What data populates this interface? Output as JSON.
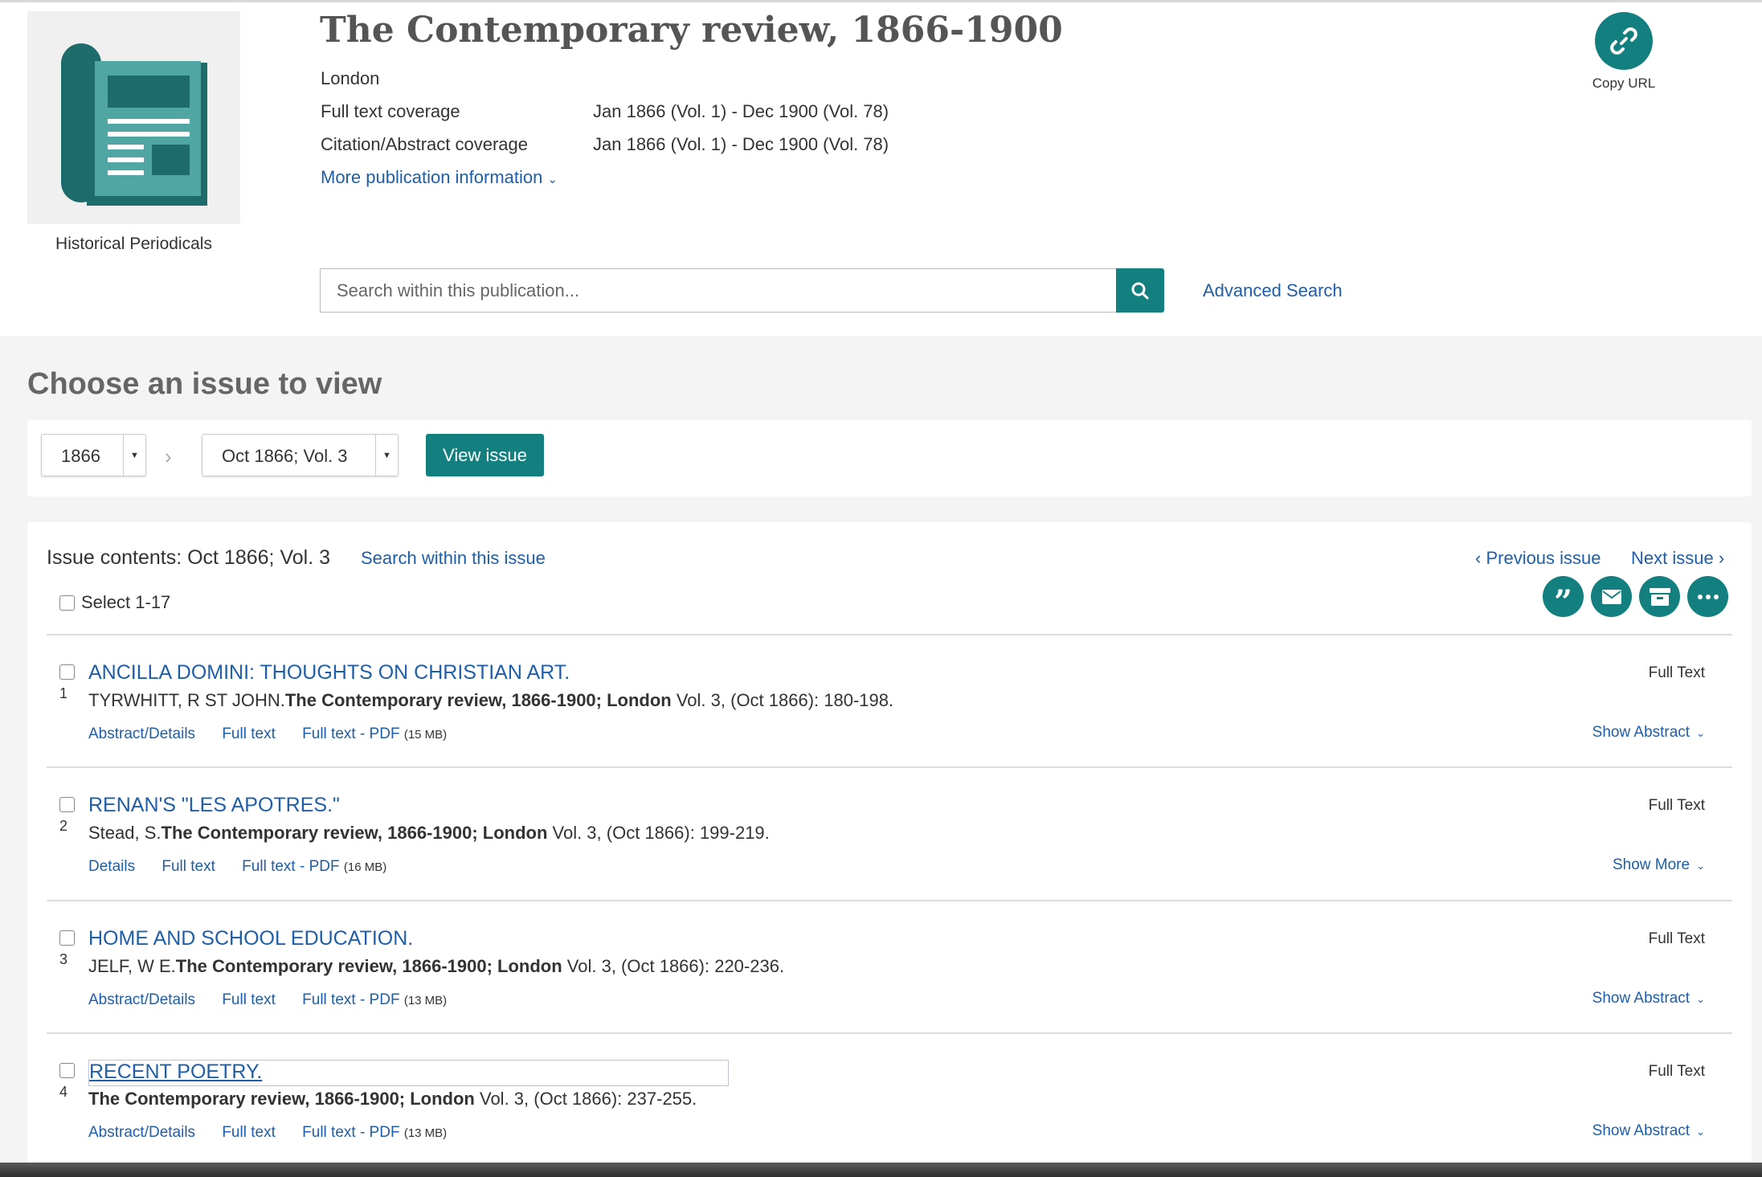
{
  "publication": {
    "badge_label": "Historical Periodicals",
    "title": "The Contemporary review, 1866-1900",
    "place": "London",
    "coverage": [
      {
        "label": "Full text coverage",
        "value": "Jan 1866 (Vol. 1) - Dec 1900 (Vol. 78)"
      },
      {
        "label": "Citation/Abstract coverage",
        "value": "Jan 1866 (Vol. 1) - Dec 1900 (Vol. 78)"
      }
    ],
    "more_info_label": "More publication information",
    "copy_url_label": "Copy URL"
  },
  "search": {
    "placeholder": "Search within this publication...",
    "advanced_label": "Advanced Search"
  },
  "issue_picker": {
    "heading": "Choose an issue to view",
    "year": "1866",
    "issue": "Oct 1866; Vol. 3",
    "view_label": "View issue"
  },
  "issue_contents": {
    "title": "Issue contents: Oct 1866; Vol. 3",
    "search_label": "Search within this issue",
    "prev_label": "Previous issue",
    "next_label": "Next issue",
    "select_label": "Select 1-17",
    "actions": [
      "cite-icon",
      "email-icon",
      "save-icon",
      "more-icon"
    ]
  },
  "articles": [
    {
      "num": "1",
      "title": "ANCILLA DOMINI: THOUGHTS ON CHRISTIAN ART.",
      "author": "TYRWHITT, R ST JOHN.",
      "source": "The Contemporary review, 1866-1900; London",
      "details": " Vol. 3,  (Oct 1866): 180-198.",
      "link1": "Abstract/Details",
      "link2": "Full text",
      "link3": "Full text - PDF",
      "size": "(15 MB)",
      "type": "Full Text",
      "toggle": "Show Abstract"
    },
    {
      "num": "2",
      "title": "RENAN'S \"LES APOTRES.\"",
      "author": "Stead, S.",
      "source": "The Contemporary review, 1866-1900; London",
      "details": " Vol. 3,  (Oct 1866): 199-219.",
      "link1": "Details",
      "link2": "Full text",
      "link3": "Full text - PDF",
      "size": "(16 MB)",
      "type": "Full Text",
      "toggle": "Show More"
    },
    {
      "num": "3",
      "title": "HOME AND SCHOOL EDUCATION.",
      "author": "JELF, W E.",
      "source": "The Contemporary review, 1866-1900; London",
      "details": " Vol. 3,  (Oct 1866): 220-236.",
      "link1": "Abstract/Details",
      "link2": "Full text",
      "link3": "Full text - PDF",
      "size": "(13 MB)",
      "type": "Full Text",
      "toggle": "Show Abstract"
    },
    {
      "num": "4",
      "title": "RECENT POETRY.",
      "author": "",
      "source": "The Contemporary review, 1866-1900; London",
      "details": " Vol. 3,  (Oct 1866): 237-255.",
      "link1": "Abstract/Details",
      "link2": "Full text",
      "link3": "Full text - PDF",
      "size": "(13 MB)",
      "type": "Full Text",
      "toggle": "Show Abstract"
    }
  ],
  "colors": {
    "accent": "#13807f",
    "link": "#1f5ea8"
  }
}
